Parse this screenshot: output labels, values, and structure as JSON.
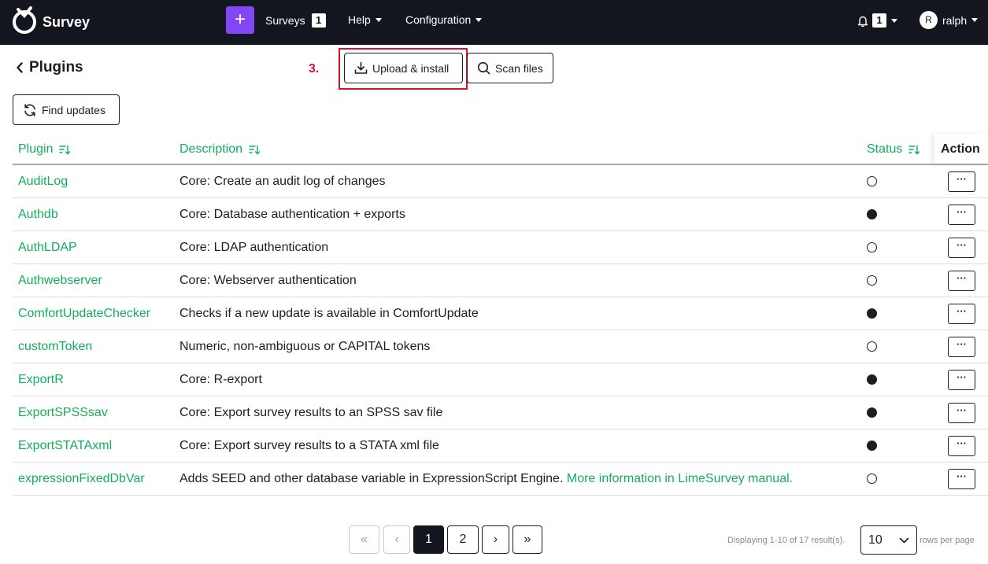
{
  "navbar": {
    "brand": "Survey",
    "new_button": "+",
    "surveys_label": "Surveys",
    "surveys_count": "1",
    "help_label": "Help",
    "config_label": "Configuration",
    "notifications_count": "1",
    "user_initial": "R",
    "user_name": "ralph"
  },
  "header": {
    "title": "Plugins",
    "step_annotation": "3.",
    "upload_label": "Upload & install",
    "scan_label": "Scan files",
    "find_updates_label": "Find updates"
  },
  "table": {
    "columns": {
      "plugin": "Plugin",
      "description": "Description",
      "status": "Status",
      "action": "Action"
    },
    "action_label": "···",
    "rows": [
      {
        "plugin": "AuditLog",
        "description": "Core: Create an audit log of changes",
        "active": false
      },
      {
        "plugin": "Authdb",
        "description": "Core: Database authentication + exports",
        "active": true
      },
      {
        "plugin": "AuthLDAP",
        "description": "Core: LDAP authentication",
        "active": false
      },
      {
        "plugin": "Authwebserver",
        "description": "Core: Webserver authentication",
        "active": false
      },
      {
        "plugin": "ComfortUpdateChecker",
        "description": "Checks if a new update is available in ComfortUpdate",
        "active": true
      },
      {
        "plugin": "customToken",
        "description": "Numeric, non-ambiguous or CAPITAL tokens",
        "active": false
      },
      {
        "plugin": "ExportR",
        "description": "Core: R-export",
        "active": true
      },
      {
        "plugin": "ExportSPSSsav",
        "description": "Core: Export survey results to an SPSS sav file",
        "active": true
      },
      {
        "plugin": "ExportSTATAxml",
        "description": "Core: Export survey results to a STATA xml file",
        "active": true
      },
      {
        "plugin": "expressionFixedDbVar",
        "description": "Adds SEED and other database variable in ExpressionScript Engine.",
        "link": "More information in LimeSurvey manual.",
        "active": false
      }
    ]
  },
  "pagination": {
    "first": "«",
    "prev": "‹",
    "page1": "1",
    "page2": "2",
    "next": "›",
    "last": "»",
    "summary": "Displaying 1-10 of 17 result(s).",
    "page_size": "10",
    "per_page_label": "rows per page"
  },
  "colors": {
    "navbar_bg": "#14161f",
    "accent_purple": "#8146f6",
    "link_green": "#14ae5c",
    "annotation_red": "#d0132e"
  }
}
